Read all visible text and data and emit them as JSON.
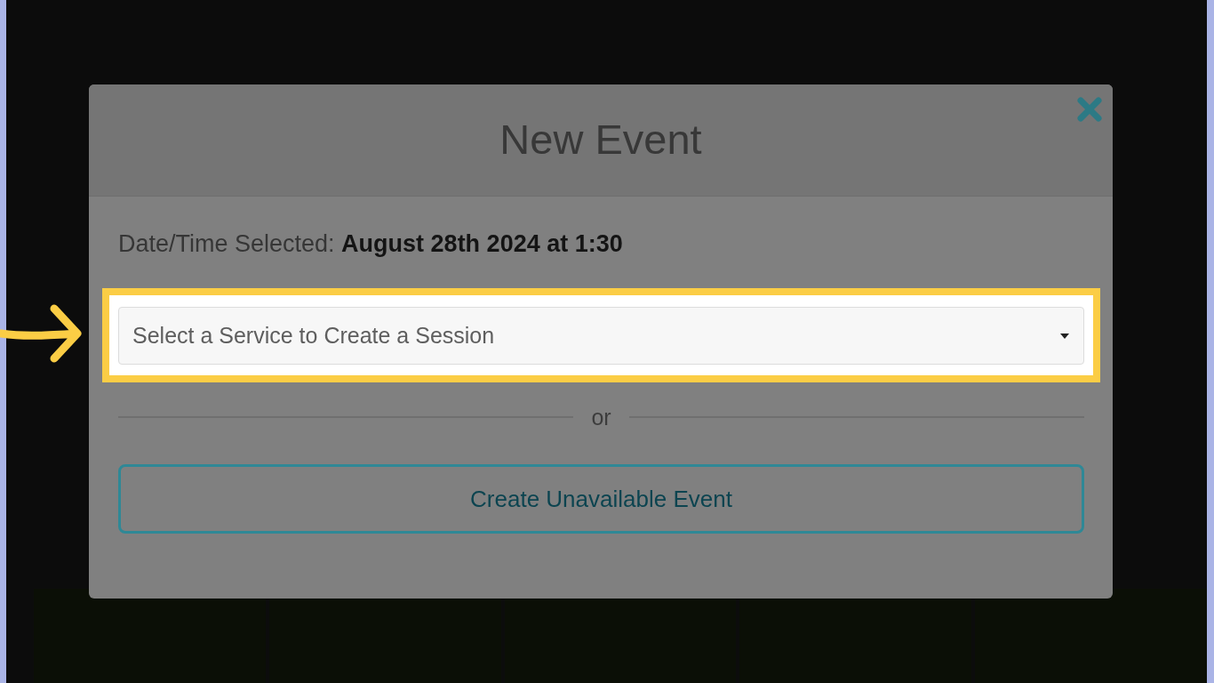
{
  "dialog": {
    "title": "New Event",
    "selection_text": "Date/Time Selected: **August 28th 2024 at 1:30**",
    "service_select": {
      "placeholder": "Select a Service to Create a Session",
      "highlighted": true
    },
    "divider_text": "or",
    "buttons": [
      "Create Unavailable Event"
    ]
  }
}
